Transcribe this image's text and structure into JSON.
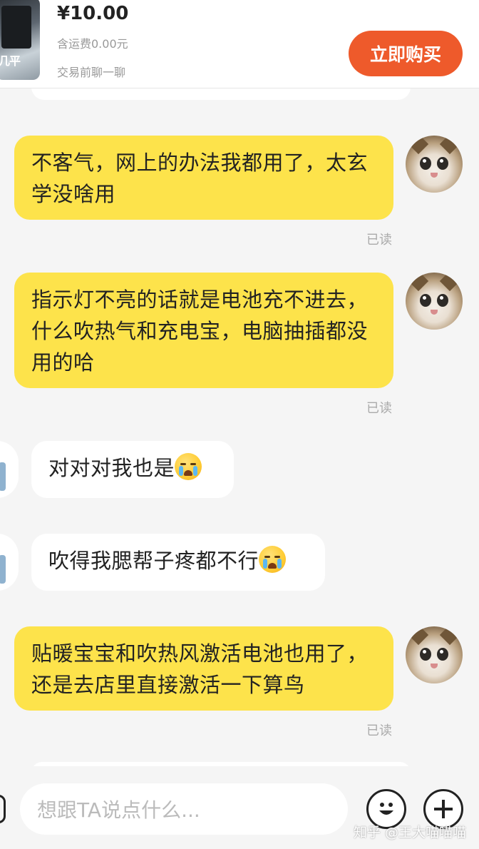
{
  "header": {
    "price": "¥10.00",
    "shipping": "含运费0.00元",
    "chat_hint": "交易前聊一聊",
    "buy_button": "立即购买",
    "thumbnail_text": "几平"
  },
  "messages": [
    {
      "sender": "me",
      "text": "不客气，网上的办法我都用了，太玄学没啥用",
      "status": "已读"
    },
    {
      "sender": "me",
      "text": "指示灯不亮的话就是电池充不进去，什么吹热气和充电宝，电脑抽插都没用的哈",
      "status": "已读"
    },
    {
      "sender": "them",
      "text": "对对对我也是",
      "emoji": "crying-face"
    },
    {
      "sender": "them",
      "text": "吹得我腮帮子疼都不行",
      "emoji": "crying-face"
    },
    {
      "sender": "me",
      "text": "贴暖宝宝和吹热风激活电池也用了，还是去店里直接激活一下算鸟",
      "status": "已读"
    }
  ],
  "input": {
    "placeholder": "想跟TA说点什么..."
  },
  "icons": {
    "emoji_button": "smiley-icon",
    "plus_button": "plus-icon"
  },
  "watermark": "知乎 @王大喵喵喵",
  "colors": {
    "accent": "#ee5a2b",
    "my_bubble": "#fde34b",
    "their_bubble": "#ffffff",
    "background": "#f5f5f5"
  }
}
